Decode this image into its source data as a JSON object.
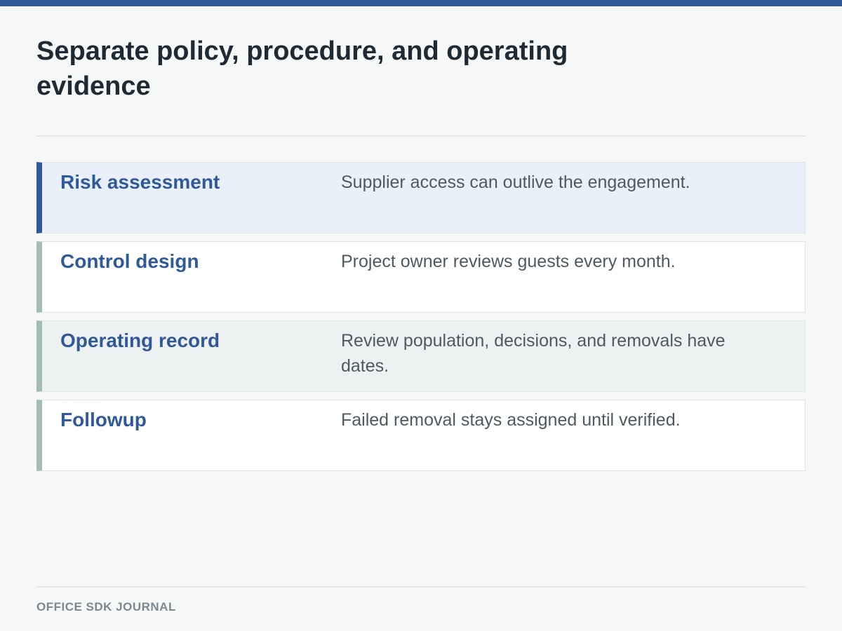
{
  "header": {
    "title": "Separate policy, procedure, and operating evidence"
  },
  "rows": [
    {
      "label": "Risk assessment",
      "text": "Supplier access can outlive the engagement."
    },
    {
      "label": "Control design",
      "text": "Project owner reviews guests every month."
    },
    {
      "label": "Operating record",
      "text": "Review population, decisions, and removals have dates."
    },
    {
      "label": "Followup",
      "text": "Failed removal stays assigned until verified."
    }
  ],
  "footer": {
    "label": "OFFICE SDK JOURNAL"
  },
  "colors": {
    "accent": "#30599a",
    "title": "#1f2b34",
    "row_text": "#4d5a62",
    "highlight_bg": "#eaf0f9",
    "inactive_marker": "#a3bcb5"
  }
}
